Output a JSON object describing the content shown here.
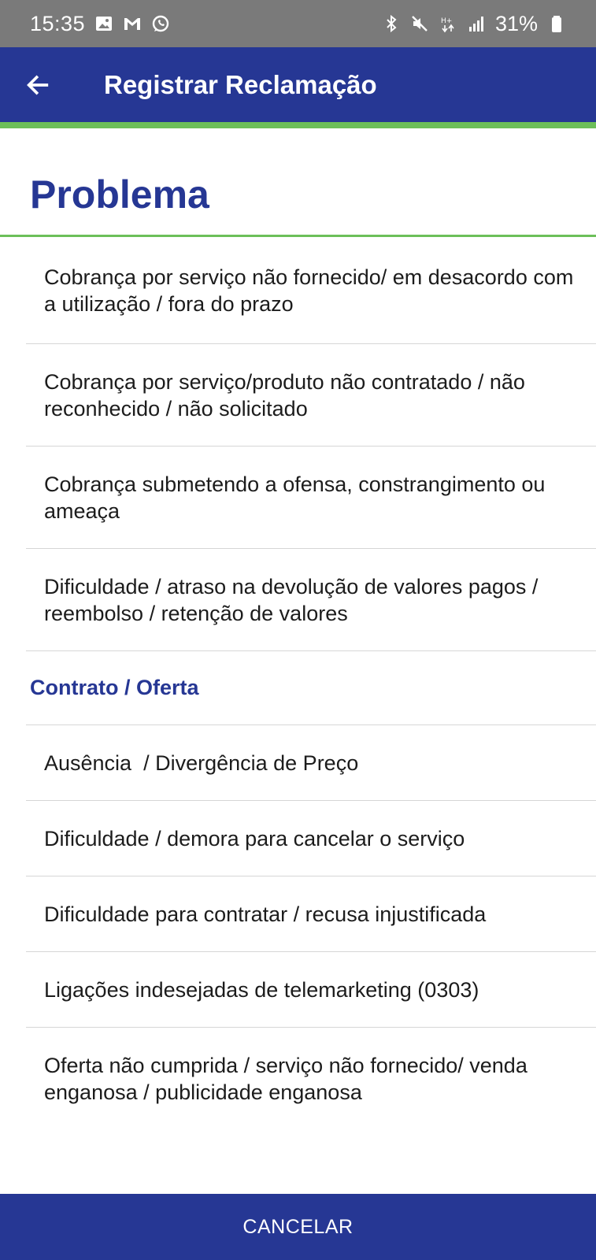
{
  "status_bar": {
    "time": "15:35",
    "battery": "31%",
    "left_icons": [
      "image-icon",
      "gmail-icon",
      "whatsapp-icon"
    ],
    "right_icons": [
      "bluetooth-icon",
      "mute-icon",
      "data-icon",
      "signal-icon",
      "battery-icon"
    ]
  },
  "app_bar": {
    "title": "Registrar Reclamação",
    "back_icon": "arrow-left-icon",
    "color": "#263794",
    "accent": "#6cbf59"
  },
  "section": {
    "title": "Problema"
  },
  "list": {
    "items": [
      {
        "label": "Cobrança por serviço não fornecido/ em desacordo com a utilização / fora do prazo"
      },
      {
        "label": "Cobrança por serviço/produto não contratado / não reconhecido / não solicitado"
      },
      {
        "label": "Cobrança submetendo a ofensa, constrangimento ou ameaça"
      },
      {
        "label": "Dificuldade / atraso na devolução de valores pagos / reembolso / retenção de valores"
      }
    ],
    "category": "Contrato / Oferta",
    "category_items": [
      {
        "label": "Ausência  / Divergência de Preço"
      },
      {
        "label": "Dificuldade / demora para cancelar o serviço"
      },
      {
        "label": "Dificuldade para contratar / recusa injustificada"
      },
      {
        "label": "Ligações indesejadas de telemarketing (0303)"
      },
      {
        "label": "Oferta não cumprida / serviço não fornecido/ venda enganosa / publicidade enganosa"
      }
    ]
  },
  "footer": {
    "cancel_label": "CANCELAR"
  }
}
